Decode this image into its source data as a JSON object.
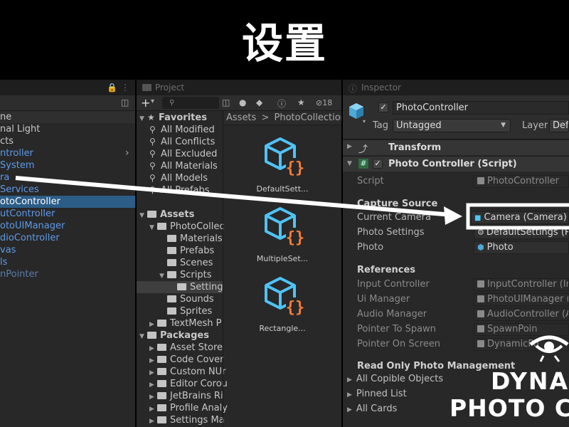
{
  "title": "设置",
  "hierarchy": {
    "items": [
      {
        "label": "ne",
        "style": "plain"
      },
      {
        "label": "nal Light",
        "style": "plain"
      },
      {
        "label": "cts",
        "style": "plain"
      },
      {
        "label": "ntroller",
        "style": "blue"
      },
      {
        "label": "System",
        "style": "blue"
      },
      {
        "label": "ra",
        "style": "blue"
      },
      {
        "label": "Services",
        "style": "blue"
      },
      {
        "label": "otoController",
        "style": "selected"
      },
      {
        "label": "utController",
        "style": "blue"
      },
      {
        "label": "otoUIManager",
        "style": "blue"
      },
      {
        "label": "dioController",
        "style": "blue"
      },
      {
        "label": "vas",
        "style": "blue"
      },
      {
        "label": "ls",
        "style": "blue"
      },
      {
        "label": "nPointer",
        "style": "faded"
      }
    ]
  },
  "project": {
    "tab_label": "Project",
    "count": "18",
    "breadcrumb": [
      "Assets",
      "PhotoCollection"
    ],
    "tree": [
      {
        "label": "Favorites",
        "indent": 0,
        "kind": "section"
      },
      {
        "label": "All Modified",
        "indent": 1,
        "kind": "search"
      },
      {
        "label": "All Conflicts",
        "indent": 1,
        "kind": "search"
      },
      {
        "label": "All Excluded",
        "indent": 1,
        "kind": "search"
      },
      {
        "label": "All Materials",
        "indent": 1,
        "kind": "search"
      },
      {
        "label": "All Models",
        "indent": 1,
        "kind": "search"
      },
      {
        "label": "All Prefabs",
        "indent": 1,
        "kind": "search"
      },
      {
        "label": "",
        "indent": 0,
        "kind": "blank"
      },
      {
        "label": "Assets",
        "indent": 0,
        "kind": "section-folder"
      },
      {
        "label": "PhotoCollec",
        "indent": 1,
        "kind": "folder-open"
      },
      {
        "label": "Materials",
        "indent": 2,
        "kind": "folder"
      },
      {
        "label": "Prefabs",
        "indent": 2,
        "kind": "folder"
      },
      {
        "label": "Scenes",
        "indent": 2,
        "kind": "folder"
      },
      {
        "label": "Scripts",
        "indent": 2,
        "kind": "folder-open"
      },
      {
        "label": "Setting",
        "indent": 3,
        "kind": "folder-selected"
      },
      {
        "label": "Sounds",
        "indent": 2,
        "kind": "folder"
      },
      {
        "label": "Sprites",
        "indent": 2,
        "kind": "folder"
      },
      {
        "label": "TextMesh P",
        "indent": 1,
        "kind": "folder-closed"
      },
      {
        "label": "Packages",
        "indent": 0,
        "kind": "section-folder"
      },
      {
        "label": "Asset Store",
        "indent": 1,
        "kind": "folder-closed"
      },
      {
        "label": "Code Cover",
        "indent": 1,
        "kind": "folder-closed"
      },
      {
        "label": "Custom NUr",
        "indent": 1,
        "kind": "folder-closed"
      },
      {
        "label": "Editor Corou",
        "indent": 1,
        "kind": "folder-closed"
      },
      {
        "label": "JetBrains Ri",
        "indent": 1,
        "kind": "folder-closed"
      },
      {
        "label": "Profile Analy",
        "indent": 1,
        "kind": "folder-closed"
      },
      {
        "label": "Settings Ma",
        "indent": 1,
        "kind": "folder-closed"
      }
    ],
    "assets": [
      {
        "label": "DefaultSett..."
      },
      {
        "label": "MultipleSet..."
      },
      {
        "label": "Rectangle..."
      }
    ]
  },
  "inspector": {
    "tab_label": "Inspector",
    "object_name": "PhotoController",
    "tag_label": "Tag",
    "tag_value": "Untagged",
    "layer_label": "Layer",
    "layer_value": "Defa",
    "transform_title": "Transform",
    "component_title": "Photo Controller (Script)",
    "script_label": "Script",
    "script_value": "PhotoController",
    "section_capture": "Capture Source",
    "current_camera_label": "Current Camera",
    "current_camera_value": "Camera (Camera)",
    "photo_settings_label": "Photo Settings",
    "photo_settings_value": "DefaultSettings (Ph",
    "photo_label": "Photo",
    "photo_value": "Photo",
    "section_refs": "References",
    "refs": [
      {
        "label": "Input Controller",
        "value": "InputController (Inpu"
      },
      {
        "label": "Ui Manager",
        "value": "PhotoUIManager (P"
      },
      {
        "label": "Audio Manager",
        "value": "AudioController (Au"
      },
      {
        "label": "Pointer To Spawn",
        "value": "SpawnPoin"
      },
      {
        "label": "Pointer On Screen",
        "value": "DynamicPo"
      }
    ],
    "section_readonly": "Read Only Photo Management",
    "readonly_items": [
      "All Copible Objects",
      "Pinned List",
      "All Cards"
    ]
  },
  "watermark": {
    "line1": "DYNAI",
    "line2": "PHOTO CA"
  },
  "colors": {
    "highlight_box": "#ffffff",
    "arrow": "#ffffff",
    "selection": "#2c5d87",
    "asset_icon_blue": "#4fc3f7",
    "asset_icon_orange": "#f57c3a"
  }
}
